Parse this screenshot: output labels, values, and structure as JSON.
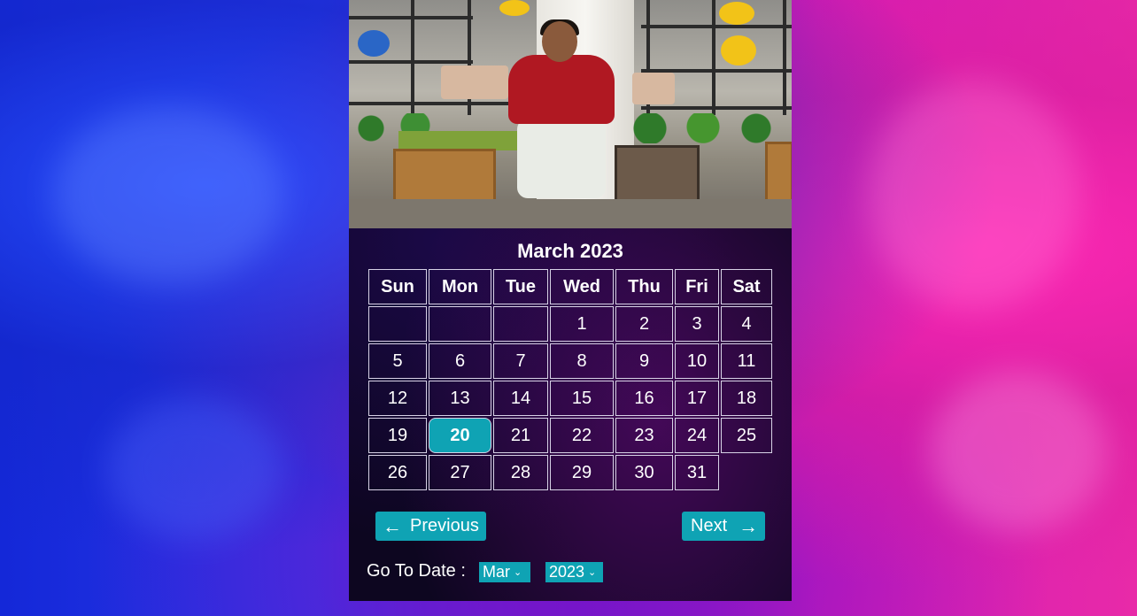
{
  "calendar": {
    "title": "March 2023",
    "weekdays": [
      "Sun",
      "Mon",
      "Tue",
      "Wed",
      "Thu",
      "Fri",
      "Sat"
    ],
    "weeks": [
      [
        "",
        "",
        "",
        "1",
        "2",
        "3",
        "4"
      ],
      [
        "5",
        "6",
        "7",
        "8",
        "9",
        "10",
        "11"
      ],
      [
        "12",
        "13",
        "14",
        "15",
        "16",
        "17",
        "18"
      ],
      [
        "19",
        "20",
        "21",
        "22",
        "23",
        "24",
        "25"
      ],
      [
        "26",
        "27",
        "28",
        "29",
        "30",
        "31",
        ""
      ]
    ],
    "today": "20"
  },
  "nav": {
    "prev_label": "Previous",
    "next_label": "Next",
    "prev_icon": "←",
    "next_icon": "→"
  },
  "goto": {
    "label": "Go To Date :",
    "month": "Mar",
    "year": "2023"
  },
  "colors": {
    "accent": "#0fa3b4",
    "sunday": "#ff1a1a"
  }
}
